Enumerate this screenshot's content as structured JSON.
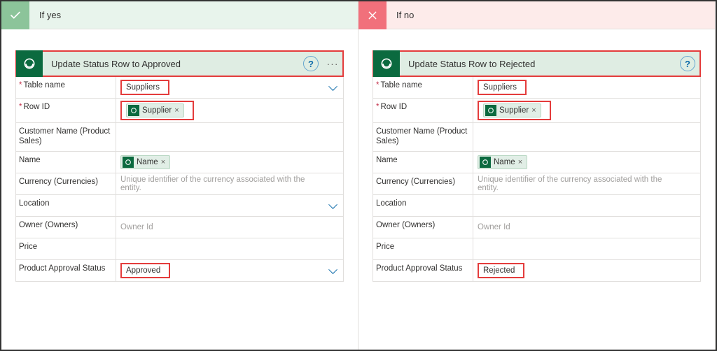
{
  "yes": {
    "title": "If yes",
    "action_title": "Update Status Row to Approved",
    "rows": {
      "table_name_label": "Table name",
      "table_name_value": "Suppliers",
      "row_id_label": "Row ID",
      "row_id_token": "Supplier",
      "customer_label": "Customer Name (Product Sales)",
      "customer_value": "",
      "name_label": "Name",
      "name_token": "Name",
      "currency_label": "Currency (Currencies)",
      "currency_placeholder": "Unique identifier of the currency associated with the entity.",
      "location_label": "Location",
      "owner_label": "Owner (Owners)",
      "owner_placeholder": "Owner Id",
      "price_label": "Price",
      "status_label": "Product Approval Status",
      "status_value": "Approved"
    }
  },
  "no": {
    "title": "If no",
    "action_title": "Update Status Row to Rejected",
    "rows": {
      "table_name_label": "Table name",
      "table_name_value": "Suppliers",
      "row_id_label": "Row ID",
      "row_id_token": "Supplier",
      "customer_label": "Customer Name (Product Sales)",
      "customer_value": "",
      "name_label": "Name",
      "name_token": "Name",
      "currency_label": "Currency (Currencies)",
      "currency_placeholder": "Unique identifier of the currency associated with the entity.",
      "location_label": "Location",
      "owner_label": "Owner (Owners)",
      "owner_placeholder": "Owner Id",
      "price_label": "Price",
      "status_label": "Product Approval Status",
      "status_value": "Rejected"
    }
  }
}
